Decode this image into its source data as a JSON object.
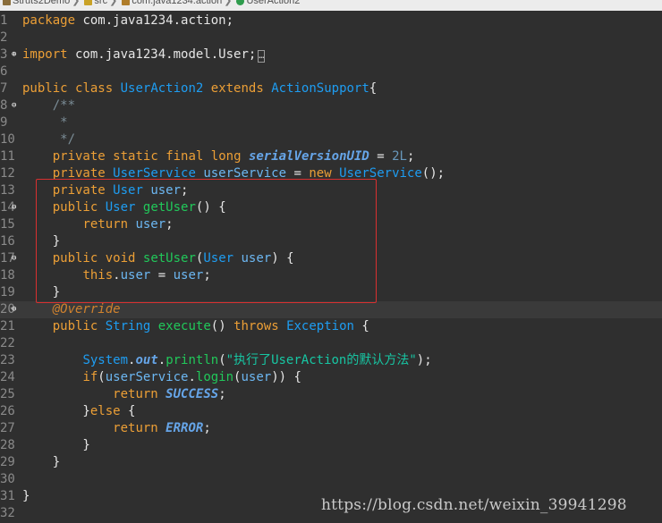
{
  "breadcrumb": {
    "items": [
      {
        "label": "Struts2Demo",
        "icon": "project-icon"
      },
      {
        "label": "src",
        "icon": "folder-icon"
      },
      {
        "label": "com.java1234.action",
        "icon": "package-icon"
      },
      {
        "label": "UserAction2",
        "icon": "class-icon"
      }
    ]
  },
  "colors": {
    "background": "#2f2f2f",
    "keyword": "#e0a545",
    "type": "#1e9df2",
    "method": "#21c85a",
    "string": "#17c6a3",
    "highlight_box": "#d93030"
  },
  "lines": [
    {
      "n": "1",
      "fold": "",
      "tokens": [
        [
          "kw2",
          "package"
        ],
        [
          "plain",
          " com.java1234.action;"
        ]
      ]
    },
    {
      "n": "2",
      "fold": "",
      "tokens": []
    },
    {
      "n": "3",
      "fold": "+",
      "tokens": [
        [
          "kw2",
          "import"
        ],
        [
          "plain",
          " com.java1234.model.User;"
        ],
        [
          "box",
          "…"
        ]
      ]
    },
    {
      "n": "6",
      "fold": "",
      "tokens": []
    },
    {
      "n": "7",
      "fold": "",
      "tokens": [
        [
          "kw2",
          "public"
        ],
        [
          "plain",
          " "
        ],
        [
          "kw2",
          "class"
        ],
        [
          "plain",
          " "
        ],
        [
          "cls",
          "UserAction2"
        ],
        [
          "plain",
          " "
        ],
        [
          "kw2",
          "extends"
        ],
        [
          "plain",
          " "
        ],
        [
          "cls",
          "ActionSupport"
        ],
        [
          "plain",
          "{"
        ]
      ]
    },
    {
      "n": "8",
      "fold": "-",
      "tokens": [
        [
          "comment",
          "    /**"
        ]
      ]
    },
    {
      "n": "9",
      "fold": "",
      "tokens": [
        [
          "comment",
          "     *"
        ]
      ]
    },
    {
      "n": "10",
      "fold": "",
      "tokens": [
        [
          "comment",
          "     */"
        ]
      ]
    },
    {
      "n": "11",
      "fold": "",
      "tokens": [
        [
          "plain",
          "    "
        ],
        [
          "kw2",
          "private"
        ],
        [
          "plain",
          " "
        ],
        [
          "kw2",
          "static"
        ],
        [
          "plain",
          " "
        ],
        [
          "kw2",
          "final"
        ],
        [
          "plain",
          " "
        ],
        [
          "kw2",
          "long"
        ],
        [
          "plain",
          " "
        ],
        [
          "staticfield",
          "serialVersionUID"
        ],
        [
          "plain",
          " = "
        ],
        [
          "num",
          "2L"
        ],
        [
          "plain",
          ";"
        ]
      ]
    },
    {
      "n": "12",
      "fold": "",
      "tokens": [
        [
          "plain",
          "    "
        ],
        [
          "kw2",
          "private"
        ],
        [
          "plain",
          " "
        ],
        [
          "cls",
          "UserService"
        ],
        [
          "plain",
          " "
        ],
        [
          "field",
          "userService"
        ],
        [
          "plain",
          " = "
        ],
        [
          "kw2",
          "new"
        ],
        [
          "plain",
          " "
        ],
        [
          "cls",
          "UserService"
        ],
        [
          "plain",
          "();"
        ]
      ]
    },
    {
      "n": "13",
      "fold": "",
      "tokens": [
        [
          "plain",
          "    "
        ],
        [
          "kw2",
          "private"
        ],
        [
          "plain",
          " "
        ],
        [
          "cls",
          "User"
        ],
        [
          "plain",
          " "
        ],
        [
          "field",
          "user"
        ],
        [
          "plain",
          ";"
        ]
      ]
    },
    {
      "n": "14",
      "fold": "-",
      "tokens": [
        [
          "plain",
          "    "
        ],
        [
          "kw2",
          "public"
        ],
        [
          "plain",
          " "
        ],
        [
          "cls",
          "User"
        ],
        [
          "plain",
          " "
        ],
        [
          "method",
          "getUser"
        ],
        [
          "plain",
          "() {"
        ]
      ]
    },
    {
      "n": "15",
      "fold": "",
      "tokens": [
        [
          "plain",
          "        "
        ],
        [
          "kw2",
          "return"
        ],
        [
          "plain",
          " "
        ],
        [
          "field",
          "user"
        ],
        [
          "plain",
          ";"
        ]
      ]
    },
    {
      "n": "16",
      "fold": "",
      "tokens": [
        [
          "plain",
          "    }"
        ]
      ]
    },
    {
      "n": "17",
      "fold": "-",
      "tokens": [
        [
          "plain",
          "    "
        ],
        [
          "kw2",
          "public"
        ],
        [
          "plain",
          " "
        ],
        [
          "kw2",
          "void"
        ],
        [
          "plain",
          " "
        ],
        [
          "method",
          "setUser"
        ],
        [
          "plain",
          "("
        ],
        [
          "cls",
          "User"
        ],
        [
          "plain",
          " "
        ],
        [
          "field",
          "user"
        ],
        [
          "plain",
          ") {"
        ]
      ]
    },
    {
      "n": "18",
      "fold": "",
      "tokens": [
        [
          "plain",
          "        "
        ],
        [
          "kw2",
          "this"
        ],
        [
          "plain",
          "."
        ],
        [
          "field",
          "user"
        ],
        [
          "plain",
          " = "
        ],
        [
          "field",
          "user"
        ],
        [
          "plain",
          ";"
        ]
      ]
    },
    {
      "n": "19",
      "fold": "",
      "tokens": [
        [
          "plain",
          "    }"
        ]
      ]
    },
    {
      "n": "20",
      "fold": "-",
      "tokens": [
        [
          "plain",
          "    "
        ],
        [
          "anno",
          "@Override"
        ]
      ]
    },
    {
      "n": "21",
      "fold": "",
      "tokens": [
        [
          "plain",
          "    "
        ],
        [
          "kw2",
          "public"
        ],
        [
          "plain",
          " "
        ],
        [
          "cls",
          "String"
        ],
        [
          "plain",
          " "
        ],
        [
          "method",
          "execute"
        ],
        [
          "plain",
          "() "
        ],
        [
          "kw2",
          "throws"
        ],
        [
          "plain",
          " "
        ],
        [
          "cls",
          "Exception"
        ],
        [
          "plain",
          " {"
        ]
      ]
    },
    {
      "n": "22",
      "fold": "",
      "tokens": []
    },
    {
      "n": "23",
      "fold": "",
      "tokens": [
        [
          "plain",
          "        "
        ],
        [
          "cls",
          "System"
        ],
        [
          "plain",
          "."
        ],
        [
          "staticfield",
          "out"
        ],
        [
          "plain",
          "."
        ],
        [
          "method",
          "println"
        ],
        [
          "plain",
          "("
        ],
        [
          "str",
          "\"执行了UserAction的默认方法\""
        ],
        [
          "plain",
          ");"
        ]
      ]
    },
    {
      "n": "24",
      "fold": "",
      "tokens": [
        [
          "plain",
          "        "
        ],
        [
          "kw2",
          "if"
        ],
        [
          "plain",
          "("
        ],
        [
          "field",
          "userService"
        ],
        [
          "plain",
          "."
        ],
        [
          "method",
          "login"
        ],
        [
          "plain",
          "("
        ],
        [
          "field",
          "user"
        ],
        [
          "plain",
          ")) {"
        ]
      ]
    },
    {
      "n": "25",
      "fold": "",
      "tokens": [
        [
          "plain",
          "            "
        ],
        [
          "kw2",
          "return"
        ],
        [
          "plain",
          " "
        ],
        [
          "staticfield",
          "SUCCESS"
        ],
        [
          "plain",
          ";"
        ]
      ]
    },
    {
      "n": "26",
      "fold": "",
      "tokens": [
        [
          "plain",
          "        }"
        ],
        [
          "kw2",
          "else"
        ],
        [
          "plain",
          " {"
        ]
      ]
    },
    {
      "n": "27",
      "fold": "",
      "tokens": [
        [
          "plain",
          "            "
        ],
        [
          "kw2",
          "return"
        ],
        [
          "plain",
          " "
        ],
        [
          "staticfield",
          "ERROR"
        ],
        [
          "plain",
          ";"
        ]
      ]
    },
    {
      "n": "28",
      "fold": "",
      "tokens": [
        [
          "plain",
          "        }"
        ]
      ]
    },
    {
      "n": "29",
      "fold": "",
      "tokens": [
        [
          "plain",
          "    }"
        ]
      ]
    },
    {
      "n": "30",
      "fold": "",
      "tokens": []
    },
    {
      "n": "31",
      "fold": "",
      "tokens": [
        [
          "plain",
          "}"
        ]
      ]
    },
    {
      "n": "32",
      "fold": "",
      "tokens": []
    }
  ],
  "watermark": "https://blog.csdn.net/weixin_39941298"
}
